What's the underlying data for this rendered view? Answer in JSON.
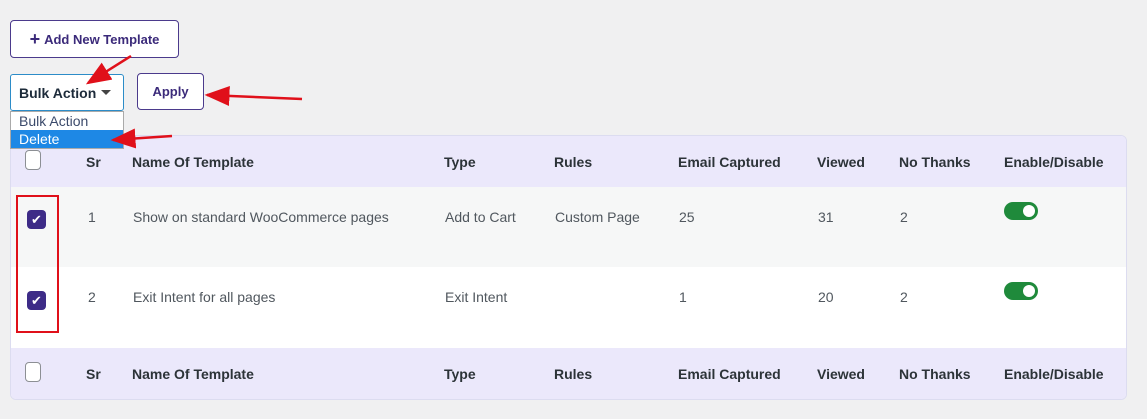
{
  "toolbar": {
    "add_label": "Add New Template",
    "add_icon": "plus-icon",
    "bulk_selected": "Bulk Action",
    "bulk_options": [
      "Bulk Action",
      "Delete"
    ],
    "bulk_highlighted": "Delete",
    "apply_label": "Apply"
  },
  "table": {
    "columns": [
      "Sr",
      "Name Of Template",
      "Type",
      "Rules",
      "Email Captured",
      "Viewed",
      "No Thanks",
      "Enable/Disable"
    ],
    "rows": [
      {
        "sr": "1",
        "name": "Show on standard WooCommerce pages",
        "type": "Add to Cart",
        "rules": "Custom Page",
        "email": "25",
        "viewed": "31",
        "no_thanks": "2",
        "enabled": true,
        "checked": true
      },
      {
        "sr": "2",
        "name": "Exit Intent for all pages",
        "type": "Exit Intent",
        "rules": "",
        "email": "1",
        "viewed": "20",
        "no_thanks": "2",
        "enabled": true,
        "checked": true
      }
    ]
  },
  "colors": {
    "accent": "#3d2b87",
    "toggle_on": "#1f8a3b",
    "header_bg": "#ebe8fb",
    "annotation_red": "#e0101a",
    "dropdown_highlight": "#1e88e5"
  }
}
